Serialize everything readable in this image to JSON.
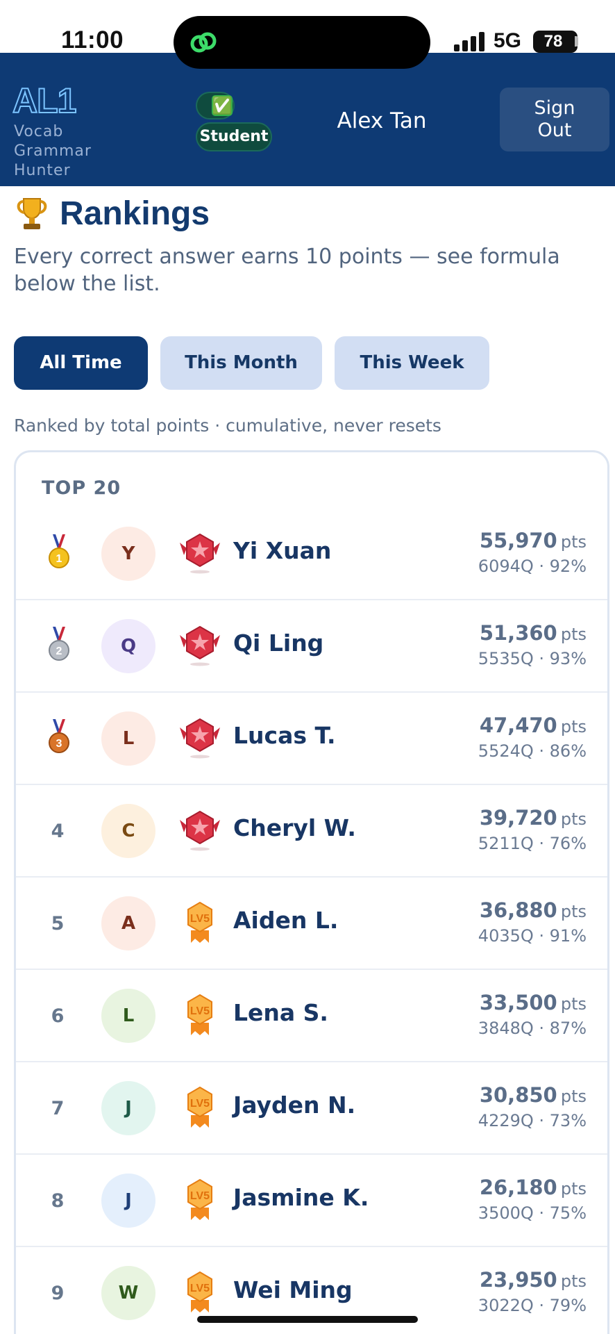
{
  "status_bar": {
    "time": "11:00",
    "network": "5G",
    "battery": "78"
  },
  "header": {
    "logo": "AL1",
    "logo_subtitle": "Vocab Grammar Hunter",
    "check_icon": "✅",
    "role_badge": "Student",
    "user_name": "Alex Tan",
    "sign_out": "Sign Out"
  },
  "page": {
    "title": "Rankings",
    "subtitle": "Every correct answer earns 10 points — see formula below the list.",
    "tabs": [
      {
        "label": "All Time",
        "active": true
      },
      {
        "label": "This Month",
        "active": false
      },
      {
        "label": "This Week",
        "active": false
      }
    ],
    "ranked_note": "Ranked by total points · cumulative, never resets"
  },
  "leaderboard": {
    "title": "TOP 20",
    "pts_unit": "pts",
    "rows": [
      {
        "rank": "1",
        "medal": "gold-medal-icon",
        "initial": "Y",
        "avatar_bg": "#fdebe4",
        "avatar_fg": "#7a2e1c",
        "badge": "red-star-badge-icon",
        "name": "Yi Xuan",
        "points": "55,970",
        "stats": "6094Q · 92%"
      },
      {
        "rank": "2",
        "medal": "silver-medal-icon",
        "initial": "Q",
        "avatar_bg": "#efeafc",
        "avatar_fg": "#4a3a86",
        "badge": "red-star-badge-icon",
        "name": "Qi Ling",
        "points": "51,360",
        "stats": "5535Q · 93%"
      },
      {
        "rank": "3",
        "medal": "bronze-medal-icon",
        "initial": "L",
        "avatar_bg": "#fdebe4",
        "avatar_fg": "#7a2e1c",
        "badge": "red-star-badge-icon",
        "name": "Lucas T.",
        "points": "47,470",
        "stats": "5524Q · 86%"
      },
      {
        "rank": "4",
        "medal": "",
        "initial": "C",
        "avatar_bg": "#fdf0de",
        "avatar_fg": "#7a4a12",
        "badge": "red-star-badge-icon",
        "name": "Cheryl W.",
        "points": "39,720",
        "stats": "5211Q · 76%"
      },
      {
        "rank": "5",
        "medal": "",
        "initial": "A",
        "avatar_bg": "#fdebe4",
        "avatar_fg": "#7a2e1c",
        "badge": "lv5-badge-icon",
        "badge_text": "LV5",
        "name": "Aiden L.",
        "points": "36,880",
        "stats": "4035Q · 91%"
      },
      {
        "rank": "6",
        "medal": "",
        "initial": "L",
        "avatar_bg": "#e8f4e0",
        "avatar_fg": "#2f5a1c",
        "badge": "lv5-badge-icon",
        "badge_text": "LV5",
        "name": "Lena S.",
        "points": "33,500",
        "stats": "3848Q · 87%"
      },
      {
        "rank": "7",
        "medal": "",
        "initial": "J",
        "avatar_bg": "#e2f5ef",
        "avatar_fg": "#1d5a48",
        "badge": "lv5-badge-icon",
        "badge_text": "LV5",
        "name": "Jayden N.",
        "points": "30,850",
        "stats": "4229Q · 73%"
      },
      {
        "rank": "8",
        "medal": "",
        "initial": "J",
        "avatar_bg": "#e4effc",
        "avatar_fg": "#1f3f78",
        "badge": "lv5-badge-icon",
        "badge_text": "LV5",
        "name": "Jasmine K.",
        "points": "26,180",
        "stats": "3500Q · 75%"
      },
      {
        "rank": "9",
        "medal": "",
        "initial": "W",
        "avatar_bg": "#e8f4e0",
        "avatar_fg": "#2f5a1c",
        "badge": "lv5-badge-icon",
        "badge_text": "LV5",
        "name": "Wei Ming",
        "points": "23,950",
        "stats": "3022Q · 79%"
      }
    ]
  },
  "colors": {
    "header_bg": "#0e3a74",
    "accent": "#0e3a74",
    "tab_inactive": "#d2def3"
  }
}
